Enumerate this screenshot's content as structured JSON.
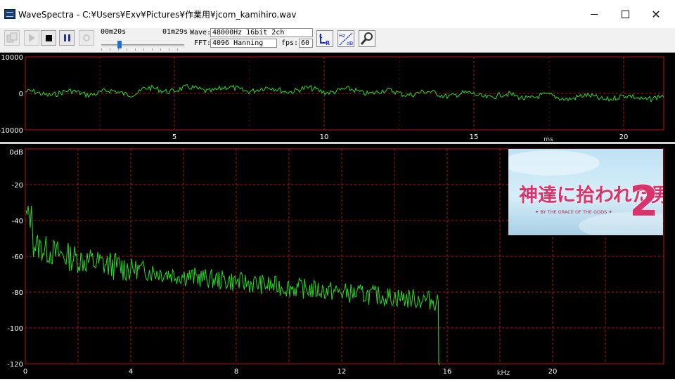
{
  "window": {
    "title": "WaveSpectra - C:¥Users¥Exv¥Pictures¥作業用¥jcom_kamihiro.wav",
    "minimize_icon": "minimize-icon",
    "maximize_icon": "maximize-icon",
    "close_icon": "close-icon",
    "close_glyph": "✕"
  },
  "toolbar": {
    "time_current": "00m20s",
    "time_total": "01m29s",
    "seek_progress": 0.22,
    "wave_label": "Wave:",
    "wave_value": "48000Hz 16bit 2ch",
    "fft_label": "FFT:",
    "fft_value": "4096 Hanning",
    "fps_label": "fps:",
    "fps_value": "60",
    "icons": [
      "open-file-icon",
      "play-icon",
      "stop-icon",
      "pause-icon",
      "record-icon",
      "channel-lr-icon",
      "hz-db-scale-icon",
      "settings-wrench-icon"
    ]
  },
  "colors": {
    "grid": "#c01010",
    "axis_text": "#ffffff",
    "trace": "#22dd22",
    "panel_bg": "#000000",
    "logo_pink": "#d8336a",
    "logo_white": "#ffffff"
  },
  "waveform": {
    "y_ticks": [
      "10000",
      "0",
      "-10000"
    ],
    "x_ticks": [
      "5",
      "10",
      "15",
      "20"
    ],
    "x_unit": "ms"
  },
  "spectrum": {
    "y_ticks": [
      "0dB",
      "-20",
      "-40",
      "-60",
      "-80",
      "-100",
      "-120"
    ],
    "x_ticks": [
      "0",
      "4",
      "8",
      "12",
      "16",
      "20"
    ],
    "x_unit": "kHz"
  },
  "logo": {
    "title": "神達に拾われた男",
    "number": "2",
    "subtitle": "✦ BY THE GRACE OF THE GODS ✦"
  }
}
